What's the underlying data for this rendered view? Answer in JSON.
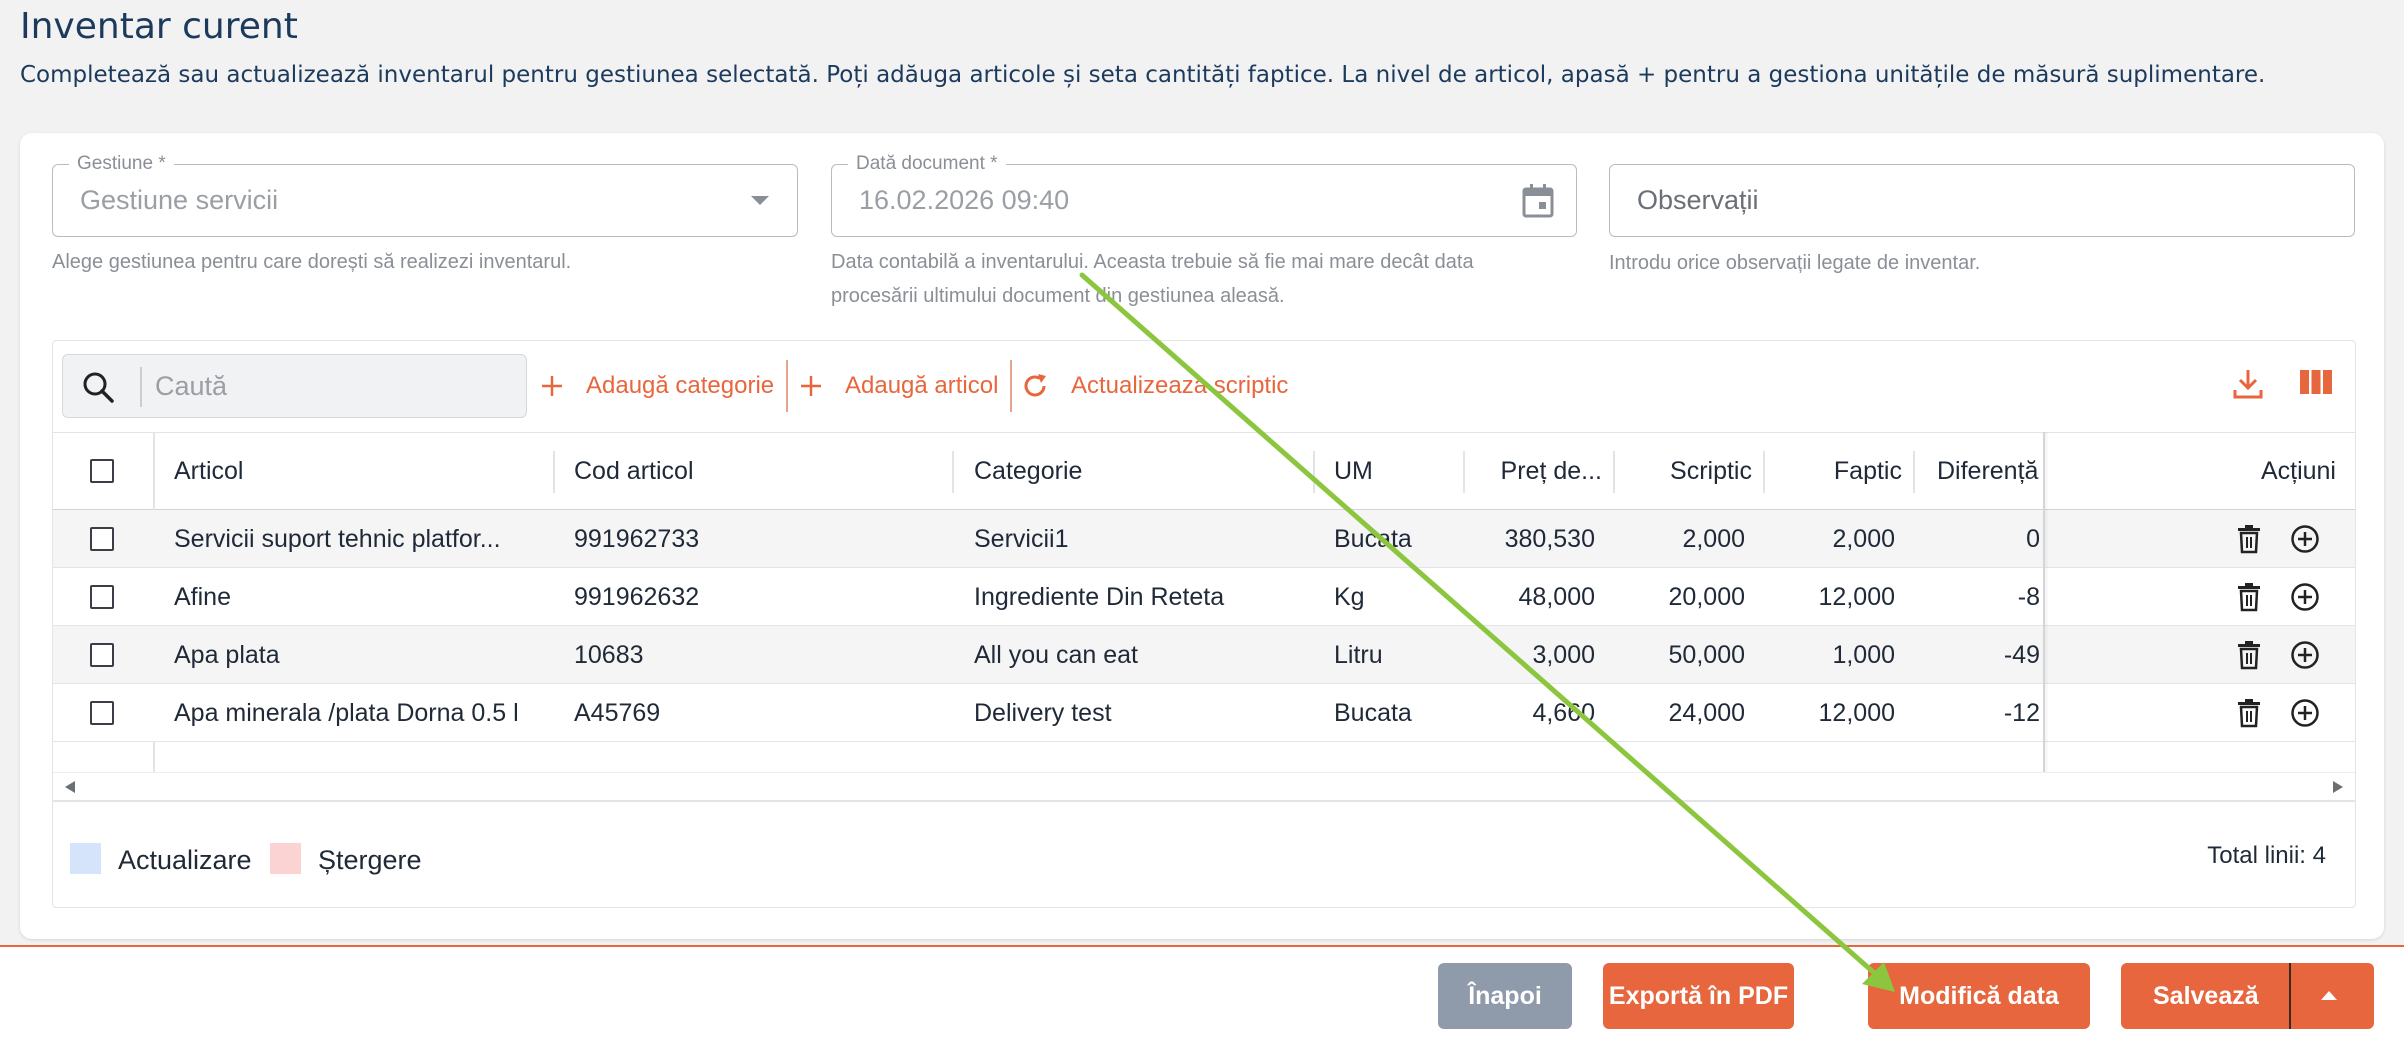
{
  "page": {
    "title": "Inventar curent",
    "description": "Completează sau actualizează inventarul pentru gestiunea selectată. Poți adăuga articole și seta cantități faptice. La nivel de articol, apasă + pentru a gestiona unitățile de măsură suplimentare."
  },
  "form": {
    "gestiune": {
      "label": "Gestiune *",
      "value": "Gestiune servicii",
      "helper": "Alege gestiunea pentru care dorești să realizezi inventarul."
    },
    "data_document": {
      "label": "Dată document *",
      "value": "16.02.2026 09:40",
      "helper_line1": "Data contabilă a inventarului. Aceasta trebuie să fie mai mare decât data",
      "helper_line2": "procesării ultimului document din gestiunea aleasă."
    },
    "observatii": {
      "placeholder": "Observații",
      "helper": "Introdu orice observații legate de inventar."
    }
  },
  "toolbar": {
    "search_placeholder": "Caută",
    "add_category": "Adaugă categorie",
    "add_article": "Adaugă articol",
    "update_scriptic": "Actualizeaza scriptic"
  },
  "table": {
    "headers": {
      "articol": "Articol",
      "cod": "Cod articol",
      "categorie": "Categorie",
      "um": "UM",
      "pret": "Preț de...",
      "scriptic": "Scriptic",
      "faptic": "Faptic",
      "diferenta": "Diferență",
      "actiuni": "Acțiuni"
    },
    "rows": [
      {
        "articol": "Servicii suport tehnic platfor...",
        "cod": "991962733",
        "categorie": "Servicii1",
        "um": "Bucata",
        "pret": "380,530",
        "scriptic": "2,000",
        "faptic": "2,000",
        "diferenta": "0"
      },
      {
        "articol": "Afine",
        "cod": "991962632",
        "categorie": "Ingrediente Din Reteta",
        "um": "Kg",
        "pret": "48,000",
        "scriptic": "20,000",
        "faptic": "12,000",
        "diferenta": "-8"
      },
      {
        "articol": "Apa plata",
        "cod": "10683",
        "categorie": "All you can eat",
        "um": "Litru",
        "pret": "3,000",
        "scriptic": "50,000",
        "faptic": "1,000",
        "diferenta": "-49"
      },
      {
        "articol": "Apa minerala /plata Dorna 0.5 l",
        "cod": "A45769",
        "categorie": "Delivery test",
        "um": "Bucata",
        "pret": "4,660",
        "scriptic": "24,000",
        "faptic": "12,000",
        "diferenta": "-12"
      }
    ]
  },
  "legend": {
    "update_label": "Actualizare",
    "update_color": "#d6e4fb",
    "delete_label": "Ștergere",
    "delete_color": "#fbd3d3"
  },
  "total_lines": "Total linii: 4",
  "actions": {
    "back": "Înapoi",
    "export_pdf": "Exportă în PDF",
    "modify_date": "Modifică data",
    "save": "Salvează"
  },
  "colors": {
    "accent": "#e8663d",
    "title": "#1b3a5c",
    "annotation_arrow": "#8cc63f"
  }
}
